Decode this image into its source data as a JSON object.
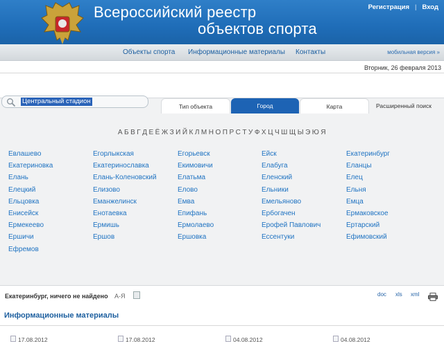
{
  "header": {
    "title_line1": "Всероссийский  реестр",
    "title_line2": "объектов спорта",
    "register_link": "Регистрация",
    "separator": "|",
    "login_link": "Вход"
  },
  "nav": {
    "items": [
      "Объекты спорта",
      "Информационные материалы",
      "Контакты"
    ],
    "mobile": "мобильная версия »"
  },
  "date": "Вторник, 26 февраля 2013",
  "search": {
    "value": "Центральный стадион"
  },
  "tabs": [
    "Тип объекта",
    "Город",
    "Карта",
    "Расширенный поиск"
  ],
  "alphabet": [
    "А",
    "Б",
    "В",
    "Г",
    "Д",
    "Е",
    "Ё",
    "Ж",
    "З",
    "И",
    "Й",
    "К",
    "Л",
    "М",
    "Н",
    "О",
    "П",
    "Р",
    "С",
    "Т",
    "У",
    "Ф",
    "Х",
    "Ц",
    "Ч",
    "Ш",
    "Щ",
    "Ы",
    "Э",
    "Ю",
    "Я"
  ],
  "cities": [
    [
      "Евлашево",
      "Екатериновка",
      "Елань",
      "Елецкий",
      "Ельцовка",
      "Енисейск",
      "Ермекеево",
      "Ершичи",
      "Ефремов"
    ],
    [
      "Егорлыкская",
      "Екатеринославка",
      "Елань-Коленовский",
      "Елизово",
      "Еманжелинск",
      "Енотаевка",
      "Ермишь",
      "Ершов"
    ],
    [
      "Егорьевск",
      "Екимовичи",
      "Елатьма",
      "Елово",
      "Емва",
      "Епифань",
      "Ермолаево",
      "Ершовка"
    ],
    [
      "Ейск",
      "Елабуга",
      "Еленский",
      "Ельники",
      "Емельяново",
      "Ербогачен",
      "Ерофей Павлович",
      "Ессентуки"
    ],
    [
      "Екатеринбург",
      "Еланцы",
      "Елец",
      "Ельня",
      "Емца",
      "Ермаковское",
      "Ертарский",
      "Ефимовский"
    ]
  ],
  "result": {
    "text": "Екатеринбург, ничего не найдено",
    "az": "А-Я",
    "formats": [
      "doc",
      "xls",
      "xml"
    ]
  },
  "section_title": "Информационные материалы",
  "news_dates": [
    "17.08.2012",
    "17.08.2012",
    "04.08.2012",
    "04.08.2012"
  ],
  "colors": {
    "header": "#1f6db8",
    "active_tab": "#1d63b4",
    "link": "#1f73c2"
  }
}
